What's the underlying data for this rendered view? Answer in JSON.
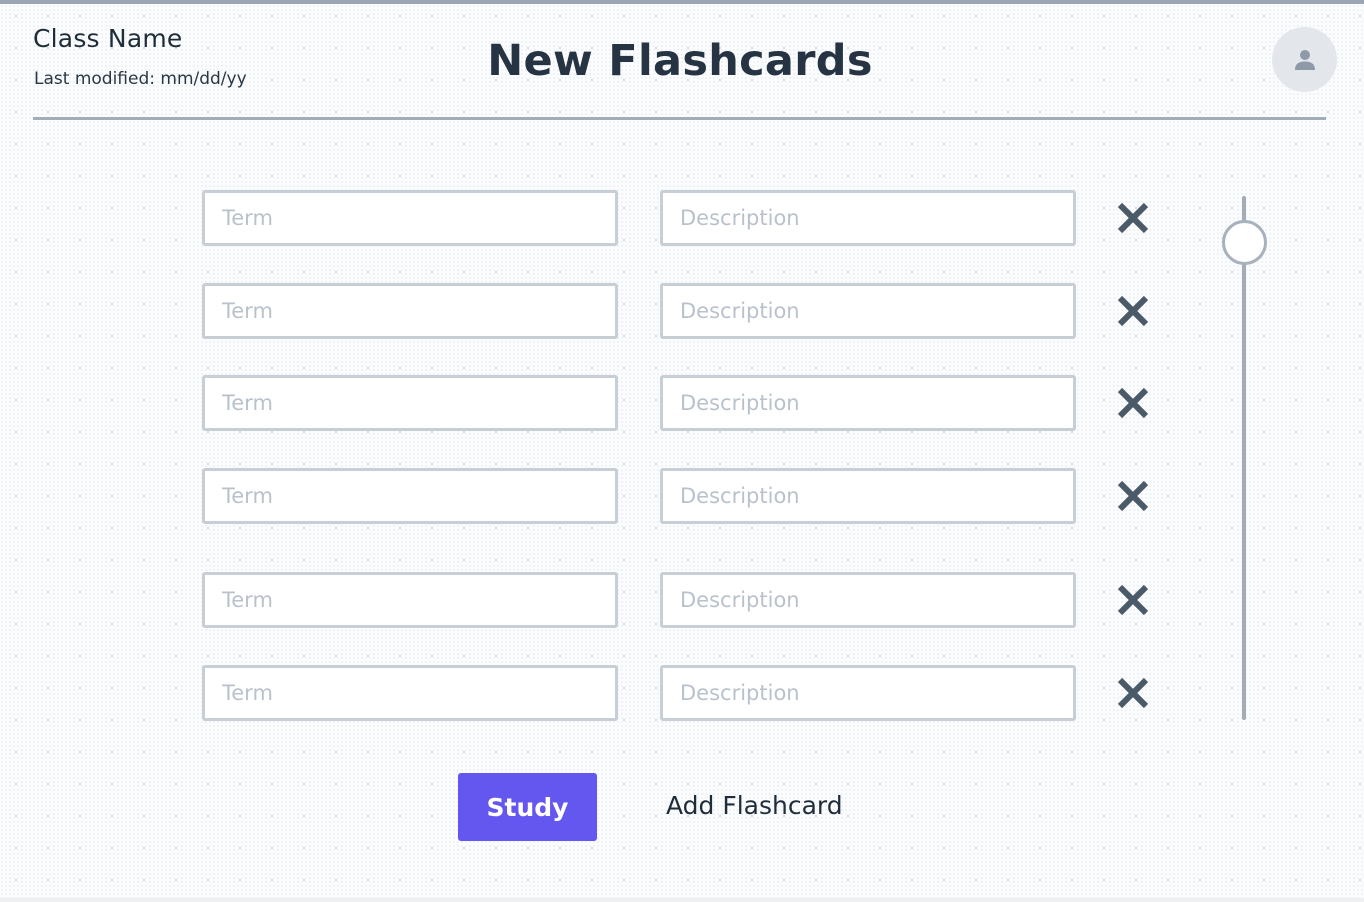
{
  "header": {
    "class_name": "Class Name",
    "last_modified": "Last modified: mm/dd/yy",
    "title": "New Flashcards"
  },
  "profile": {
    "icon": "user-icon"
  },
  "flashcards": [
    {
      "term_placeholder": "Term",
      "description_placeholder": "Description",
      "remove_icon": "close-icon"
    },
    {
      "term_placeholder": "Term",
      "description_placeholder": "Description",
      "remove_icon": "close-icon"
    },
    {
      "term_placeholder": "Term",
      "description_placeholder": "Description",
      "remove_icon": "close-icon"
    },
    {
      "term_placeholder": "Term",
      "description_placeholder": "Description",
      "remove_icon": "close-icon"
    },
    {
      "term_placeholder": "Term",
      "description_placeholder": "Description",
      "remove_icon": "close-icon"
    },
    {
      "term_placeholder": "Term",
      "description_placeholder": "Description",
      "remove_icon": "close-icon"
    }
  ],
  "actions": {
    "study_label": "Study",
    "add_label": "Add Flashcard"
  },
  "colors": {
    "accent": "#6457f0",
    "text_dark": "#253342",
    "border": "#c7ced6",
    "placeholder": "#b9c2cc",
    "icon": "#4b5a69"
  }
}
